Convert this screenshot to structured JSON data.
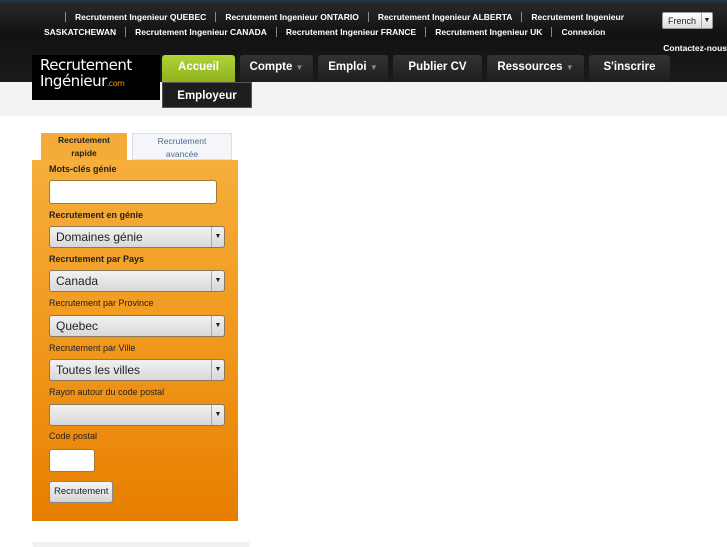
{
  "top_links": {
    "row1": [
      "Recrutement Ingenieur QUEBEC",
      "Recrutement Ingenieur ONTARIO",
      "Recrutement Ingenieur ALBERTA",
      "Recrutement Ingenieur"
    ],
    "row2": [
      "SASKATCHEWAN",
      "Recrutement Ingenieur CANADA",
      "Recrutement Ingenieur FRANCE",
      "Recrutement Ingenieur UK",
      "Connexion"
    ],
    "contact": "Contactez-nous"
  },
  "language": "French",
  "logo": {
    "line1": "Recrutement",
    "line2": "Ingénieur",
    "suffix": ".com"
  },
  "nav": [
    "Accueil",
    "Compte",
    "Emploi",
    "Publier CV",
    "Ressources",
    "S'inscrire"
  ],
  "submenu": "Employeur",
  "tabs": {
    "quick": [
      "Recrutement",
      "rapide"
    ],
    "advanced": [
      "Recrutement",
      "avancée"
    ]
  },
  "form": {
    "keywords_label": "Mots-clés génie",
    "keywords_value": "",
    "field_label": "Recrutement en génie",
    "field_value": "Domaines génie",
    "country_label": "Recrutement par Pays",
    "country_value": "Canada",
    "province_label": "Recrutement par Province",
    "province_value": "Quebec",
    "city_label": "Recrutement par Ville",
    "city_value": "Toutes les villes",
    "radius_label": "Rayon autour du code postal",
    "radius_value": "",
    "postal_label": "Code postal",
    "postal_value": "",
    "submit": "Recrutement"
  },
  "colors": {
    "active_nav": "#9fc12a",
    "panel": "#f0961a"
  }
}
